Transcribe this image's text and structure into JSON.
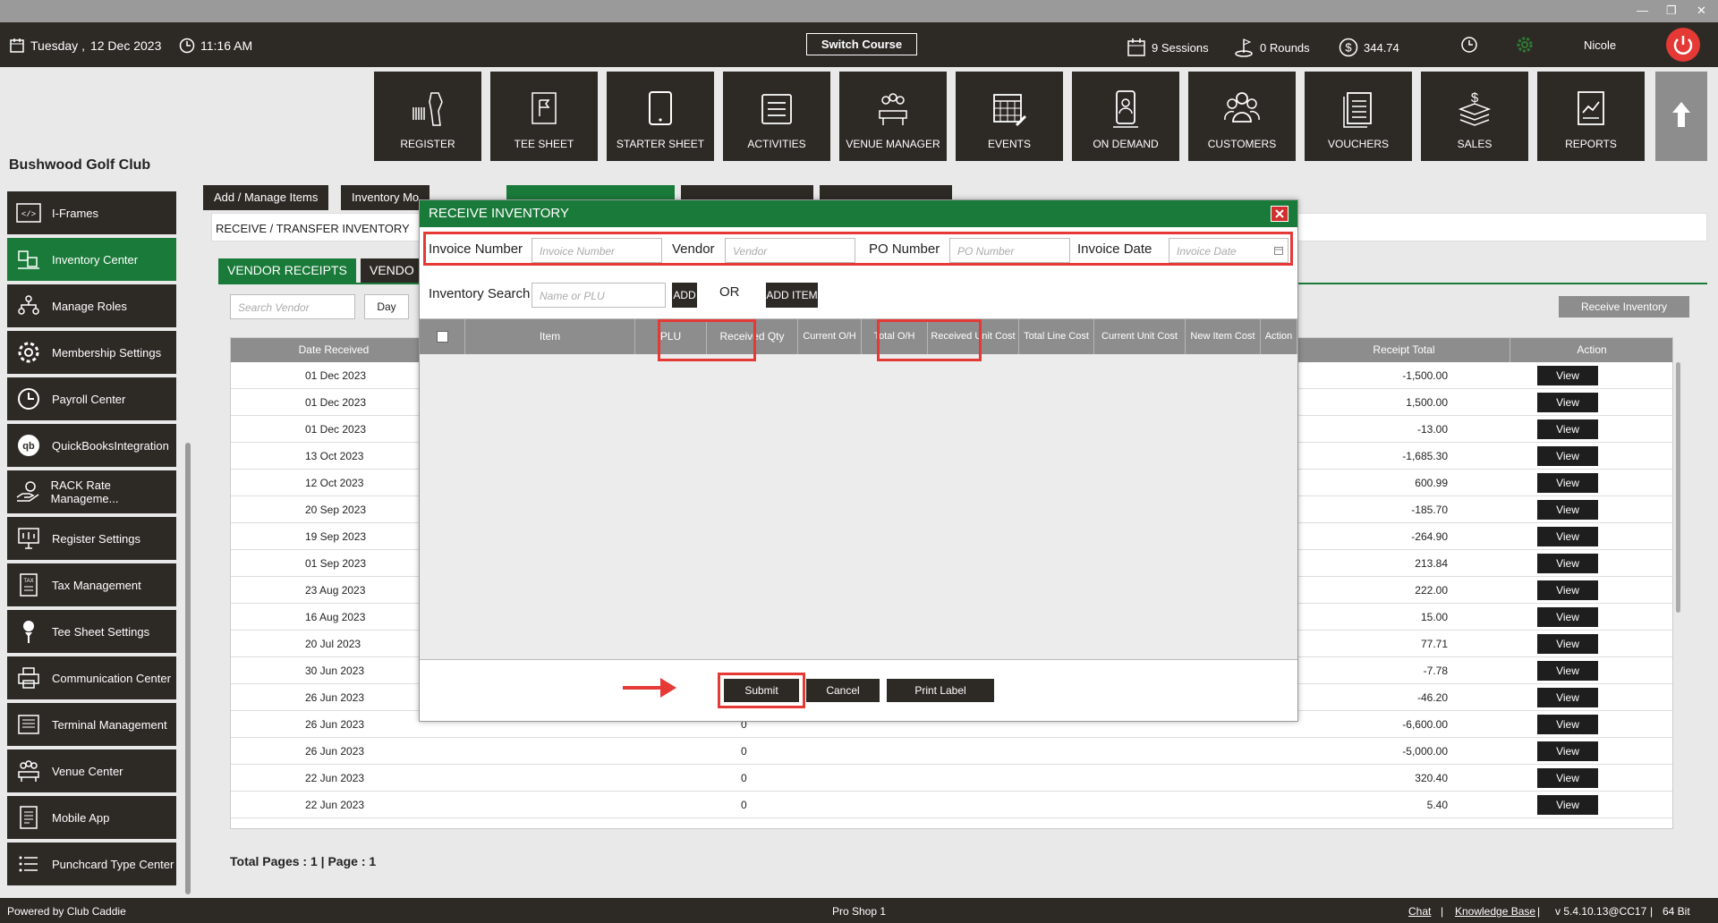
{
  "window": {
    "min": "—",
    "restore": "❐",
    "close": "✕"
  },
  "topbar": {
    "day": "Tuesday ,",
    "date": "12 Dec 2023",
    "time": "11:16 AM",
    "switch_course": "Switch Course",
    "sessions": "9 Sessions",
    "rounds": "0 Rounds",
    "balance": "344.74",
    "user": "Nicole"
  },
  "tiles": [
    "REGISTER",
    "TEE SHEET",
    "STARTER SHEET",
    "ACTIVITIES",
    "VENUE MANAGER",
    "EVENTS",
    "ON DEMAND",
    "CUSTOMERS",
    "VOUCHERS",
    "SALES",
    "REPORTS"
  ],
  "club_name": "Bushwood Golf Club",
  "sidebar": [
    "I-Frames",
    "Inventory Center",
    "Manage Roles",
    "Membership Settings",
    "Payroll Center",
    "QuickBooksIntegration",
    "RACK Rate Manageme...",
    "Register Settings",
    "Tax Management",
    "Tee Sheet Settings",
    "Communication Center",
    "Terminal Management",
    "Venue Center",
    "Mobile App",
    "Punchcard Type Center"
  ],
  "tabs": [
    "Add / Manage Items",
    "Inventory Mo"
  ],
  "panel_title": "RECEIVE / TRANSFER INVENTORY",
  "subtabs": [
    "VENDOR RECEIPTS",
    "VENDO"
  ],
  "search_vendor_placeholder": "Search Vendor",
  "day_button": "Day",
  "receive_inventory_button": "Receive Inventory",
  "grid": {
    "headers": {
      "date": "Date Received",
      "total": "Receipt Total",
      "action": "Action"
    },
    "view_label": "View",
    "rows": [
      {
        "date": "01 Dec 2023",
        "qty": "",
        "total": "-1,500.00"
      },
      {
        "date": "01 Dec 2023",
        "qty": "",
        "total": "1,500.00"
      },
      {
        "date": "01 Dec 2023",
        "qty": "",
        "total": "-13.00"
      },
      {
        "date": "13 Oct 2023",
        "qty": "",
        "total": "-1,685.30"
      },
      {
        "date": "12 Oct 2023",
        "qty": "",
        "total": "600.99"
      },
      {
        "date": "20 Sep 2023",
        "qty": "",
        "total": "-185.70"
      },
      {
        "date": "19 Sep 2023",
        "qty": "",
        "total": "-264.90"
      },
      {
        "date": "01 Sep 2023",
        "qty": "",
        "total": "213.84"
      },
      {
        "date": "23 Aug 2023",
        "qty": "",
        "total": "222.00"
      },
      {
        "date": "16 Aug 2023",
        "qty": "",
        "total": "15.00"
      },
      {
        "date": "20 Jul 2023",
        "qty": "",
        "total": "77.71"
      },
      {
        "date": "30 Jun 2023",
        "qty": "",
        "total": "-7.78"
      },
      {
        "date": "26 Jun 2023",
        "qty": "",
        "total": "-46.20"
      },
      {
        "date": "26 Jun 2023",
        "qty": "0",
        "total": "-6,600.00"
      },
      {
        "date": "26 Jun 2023",
        "qty": "0",
        "total": "-5,000.00"
      },
      {
        "date": "22 Jun 2023",
        "qty": "0",
        "total": "320.40"
      },
      {
        "date": "22 Jun 2023",
        "qty": "0",
        "total": "5.40"
      }
    ]
  },
  "pages_text": "Total Pages : 1 | Page : 1",
  "footer": {
    "powered": "Powered by Club Caddie",
    "station": "Pro Shop 1",
    "chat": "Chat",
    "kb": "Knowledge Base",
    "version": "v 5.4.10.13@CC17",
    "bits": "64 Bit",
    "sep": "|"
  },
  "modal": {
    "title": "RECEIVE INVENTORY",
    "invoice_number_label": "Invoice Number",
    "invoice_number_ph": "Invoice Number",
    "vendor_label": "Vendor",
    "vendor_ph": "Vendor",
    "po_label": "PO Number",
    "po_ph": "PO Number",
    "invoice_date_label": "Invoice Date",
    "invoice_date_ph": "Invoice Date",
    "inventory_search_label": "Inventory Search",
    "search_ph": "Name or PLU",
    "add": "ADD",
    "or": "OR",
    "add_item": "ADD ITEM",
    "columns": [
      "Item",
      "PLU",
      "Received Qty",
      "Current O/H",
      "Total O/H",
      "Received Unit Cost",
      "Total Line Cost",
      "Current Unit Cost",
      "New Item Cost",
      "Action"
    ],
    "submit": "Submit",
    "cancel": "Cancel",
    "print_label": "Print Label"
  },
  "colors": {
    "dark": "#2d2a26",
    "green": "#1a7a3a",
    "highlight": "#e53935"
  }
}
